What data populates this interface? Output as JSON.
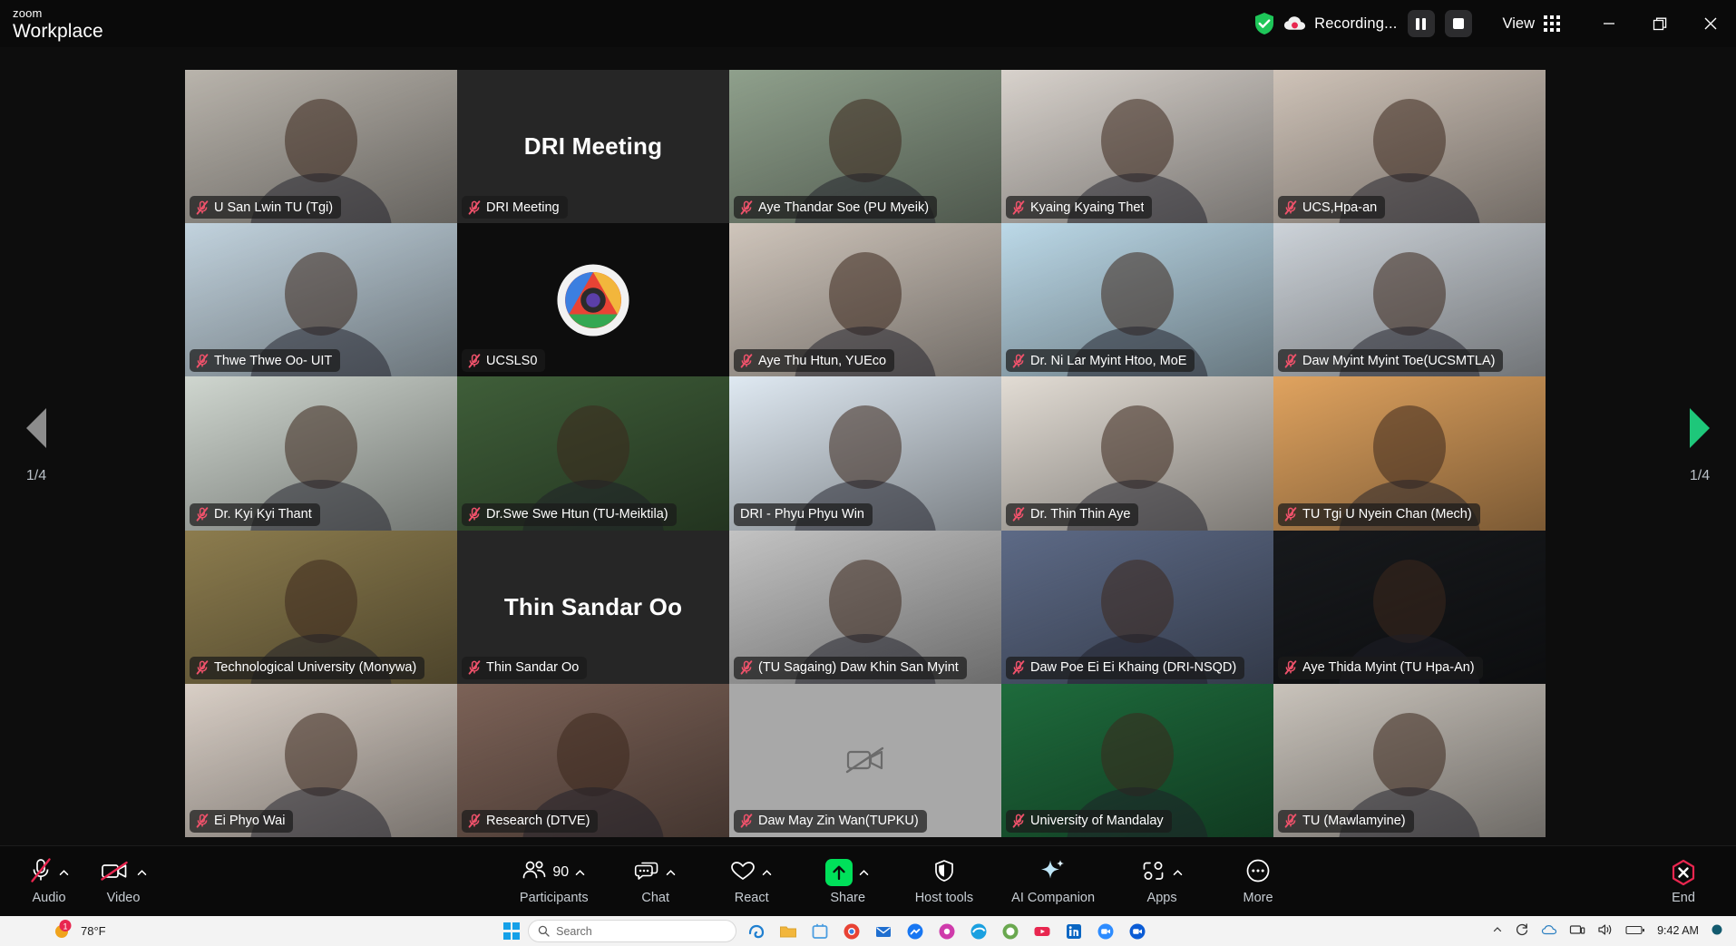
{
  "app": {
    "brand_small": "zoom",
    "brand_large": "Workplace"
  },
  "titlebar": {
    "security_icon": "shield-check-icon",
    "recording_icon": "cloud-record-icon",
    "recording_label": "Recording...",
    "pause_recording_icon": "pause-icon",
    "stop_recording_icon": "stop-icon",
    "view_label": "View",
    "view_icon": "grid-view-icon",
    "minimize_icon": "minimize-icon",
    "restore_icon": "restore-icon",
    "close_icon": "close-icon",
    "accent_green": "#00e05a",
    "accent_red": "#e8264f"
  },
  "stage": {
    "prev_page_icon": "chevron-left-icon",
    "next_page_icon": "chevron-right-icon",
    "page_left_label": "1/4",
    "page_right_label": "1/4",
    "active_border_color": "#00e05a",
    "participants": [
      {
        "name": "U San Lwin TU (Tgi)",
        "muted": true,
        "display": "video",
        "bg": "#b9b4ac"
      },
      {
        "name": "DRI Meeting",
        "muted": true,
        "display": "name",
        "bg": "#262626"
      },
      {
        "name": "Aye Thandar Soe (PU Myeik)",
        "muted": true,
        "display": "video",
        "bg": "#8fa08c"
      },
      {
        "name": "Kyaing Kyaing Thet",
        "muted": true,
        "display": "video",
        "bg": "#d8d2cc"
      },
      {
        "name": "UCS,Hpa-an",
        "muted": true,
        "display": "video",
        "bg": "#cfc3b8"
      },
      {
        "name": "Thwe Thwe Oo- UIT",
        "muted": true,
        "display": "video",
        "bg": "#c2d3de"
      },
      {
        "name": "UCSLS0",
        "muted": true,
        "display": "logo",
        "bg": "#0d0d0d"
      },
      {
        "name": "Aye Thu Htun, YUEco",
        "muted": true,
        "display": "video",
        "bg": "#cfc5bb"
      },
      {
        "name": "Dr. Ni Lar Myint Htoo, MoE",
        "muted": true,
        "display": "video",
        "bg": "#bcd9e8"
      },
      {
        "name": "Daw Myint Myint Toe(UCSMTLA)",
        "muted": true,
        "display": "video",
        "bg": "#cdd3d9"
      },
      {
        "name": "Dr. Kyi Kyi Thant",
        "muted": true,
        "display": "video",
        "bg": "#cfd6cf"
      },
      {
        "name": "Dr.Swe Swe Htun (TU-Meiktila)",
        "muted": true,
        "display": "video",
        "bg": "#3f5e39"
      },
      {
        "name": "DRI - Phyu Phyu Win",
        "muted": false,
        "display": "video",
        "bg": "#dfe9f2"
      },
      {
        "name": "Dr. Thin Thin Aye",
        "muted": true,
        "display": "video",
        "bg": "#e2dcd4"
      },
      {
        "name": "TU Tgi U Nyein Chan (Mech)",
        "muted": true,
        "display": "video",
        "bg": "#e0a35f"
      },
      {
        "name": "Technological University (Monywa)",
        "muted": true,
        "display": "video",
        "bg": "#8c7c4e"
      },
      {
        "name": "Thin Sandar Oo",
        "muted": true,
        "display": "name",
        "bg": "#262626"
      },
      {
        "name": "(TU Sagaing) Daw Khin San Myint",
        "muted": true,
        "display": "video",
        "bg": "#c3c3c3"
      },
      {
        "name": "Daw Poe Ei Ei Khaing (DRI-NSQD)",
        "muted": true,
        "display": "video",
        "bg": "#5d6a86",
        "active": true
      },
      {
        "name": "Aye Thida Myint (TU Hpa-An)",
        "muted": true,
        "display": "video",
        "bg": "#17191c"
      },
      {
        "name": "Ei Phyo Wai",
        "muted": true,
        "display": "video",
        "bg": "#d9cfc6"
      },
      {
        "name": "Research (DTVE)",
        "muted": true,
        "display": "video",
        "bg": "#7c6257"
      },
      {
        "name": "Daw May Zin Wan(TUPKU)",
        "muted": true,
        "display": "camoff",
        "bg": "#a8a8a8"
      },
      {
        "name": "University of Mandalay",
        "muted": true,
        "display": "video",
        "bg": "#1e6b3c"
      },
      {
        "name": "TU (Mawlamyine)",
        "muted": true,
        "display": "video",
        "bg": "#c9c3bb"
      }
    ]
  },
  "toolbar": {
    "audio": {
      "label": "Audio",
      "icon": "microphone-muted-icon",
      "has_caret": true
    },
    "video": {
      "label": "Video",
      "icon": "camera-muted-icon",
      "has_caret": true
    },
    "participants": {
      "label": "Participants",
      "icon": "participants-icon",
      "count": "90",
      "has_caret": true
    },
    "chat": {
      "label": "Chat",
      "icon": "chat-icon",
      "has_caret": true
    },
    "react": {
      "label": "React",
      "icon": "heart-icon",
      "has_caret": true
    },
    "share": {
      "label": "Share",
      "icon": "share-screen-icon",
      "has_caret": true
    },
    "host_tools": {
      "label": "Host tools",
      "icon": "shield-host-icon",
      "has_caret": false
    },
    "ai_companion": {
      "label": "AI Companion",
      "icon": "sparkle-icon",
      "has_caret": false
    },
    "apps": {
      "label": "Apps",
      "icon": "apps-icon",
      "has_caret": true
    },
    "more": {
      "label": "More",
      "icon": "more-dots-icon",
      "has_caret": false
    },
    "end": {
      "label": "End",
      "icon": "end-call-icon",
      "color": "#e8264f"
    }
  },
  "taskbar": {
    "weather_badge": "1",
    "weather_text": "78°F",
    "start_icon": "windows-start-icon",
    "search_icon": "search-icon",
    "search_placeholder": "Search",
    "tray_icons": [
      "chevron-up-icon",
      "refresh-icon",
      "onedrive-icon",
      "network-icon",
      "volume-icon",
      "battery-icon"
    ],
    "clock_time": "9:42 AM"
  }
}
